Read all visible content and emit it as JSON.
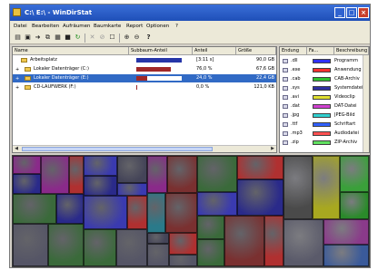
{
  "window": {
    "title": "C:\\ E:\\ - WinDirStat"
  },
  "titlebar_buttons": {
    "minimize": "_",
    "maximize": "□",
    "close": "×"
  },
  "menu": [
    "Datei",
    "Bearbeiten",
    "Aufräumen",
    "Baumkarte",
    "Report",
    "Optionen",
    "?"
  ],
  "toolbar_icons": [
    "open-icon",
    "save-icon",
    "arrow-icon",
    "copy-icon",
    "explorer-icon",
    "terminal-icon",
    "refresh-icon",
    "delete-icon",
    "delete-forever-icon",
    "properties-icon",
    "zoom-in-icon",
    "zoom-out-icon",
    "help-icon"
  ],
  "tree": {
    "columns": [
      "Name",
      "Subbaum-Anteil",
      "Anteil",
      "Größe"
    ],
    "rows": [
      {
        "expander": "",
        "name": "Arbeitsplatz",
        "share": "[3:11 s]",
        "size": "90,0 GB",
        "bar": 1.0,
        "bar_color": "#2636a8",
        "selected": false
      },
      {
        "expander": "+",
        "name": "Lokaler Datenträger (C:)",
        "share": "76,0 %",
        "size": "67,6 GB",
        "bar": 0.76,
        "bar_color": "#a02828",
        "selected": false
      },
      {
        "expander": "+",
        "name": "Lokaler Datenträger (E:)",
        "share": "24,0 %",
        "size": "22,4 GB",
        "bar": 0.24,
        "bar_color": "#a02828",
        "selected": true
      },
      {
        "expander": "+",
        "name": "CD-LAUFWERK (F:)",
        "share": "0,0 %",
        "size": "121,0 KB",
        "bar": 0.02,
        "bar_color": "#a02828",
        "selected": false
      }
    ]
  },
  "extensions": {
    "columns": [
      "Endung",
      "Fa...",
      "Beschreibung"
    ],
    "rows": [
      {
        "ext": ".dll",
        "color": "#3030ff",
        "desc": "Programm"
      },
      {
        "ext": ".exe",
        "color": "#ff3030",
        "desc": "Anwendung"
      },
      {
        "ext": ".cab",
        "color": "#30c030",
        "desc": "CAB-Archiv"
      },
      {
        "ext": ".sys",
        "color": "#3030a0",
        "desc": "Systemdatei"
      },
      {
        "ext": ".avi",
        "color": "#e0e030",
        "desc": "Videoclip"
      },
      {
        "ext": ".dat",
        "color": "#d040d0",
        "desc": "DAT-Datei"
      },
      {
        "ext": ".jpg",
        "color": "#30d0d0",
        "desc": "JPEG-Bild"
      },
      {
        "ext": ".ttf",
        "color": "#3060ff",
        "desc": "Schriftart"
      },
      {
        "ext": ".mp3",
        "color": "#ff5050",
        "desc": "Audiodatei"
      },
      {
        "ext": ".zip",
        "color": "#60e060",
        "desc": "ZIP-Archiv"
      }
    ]
  }
}
